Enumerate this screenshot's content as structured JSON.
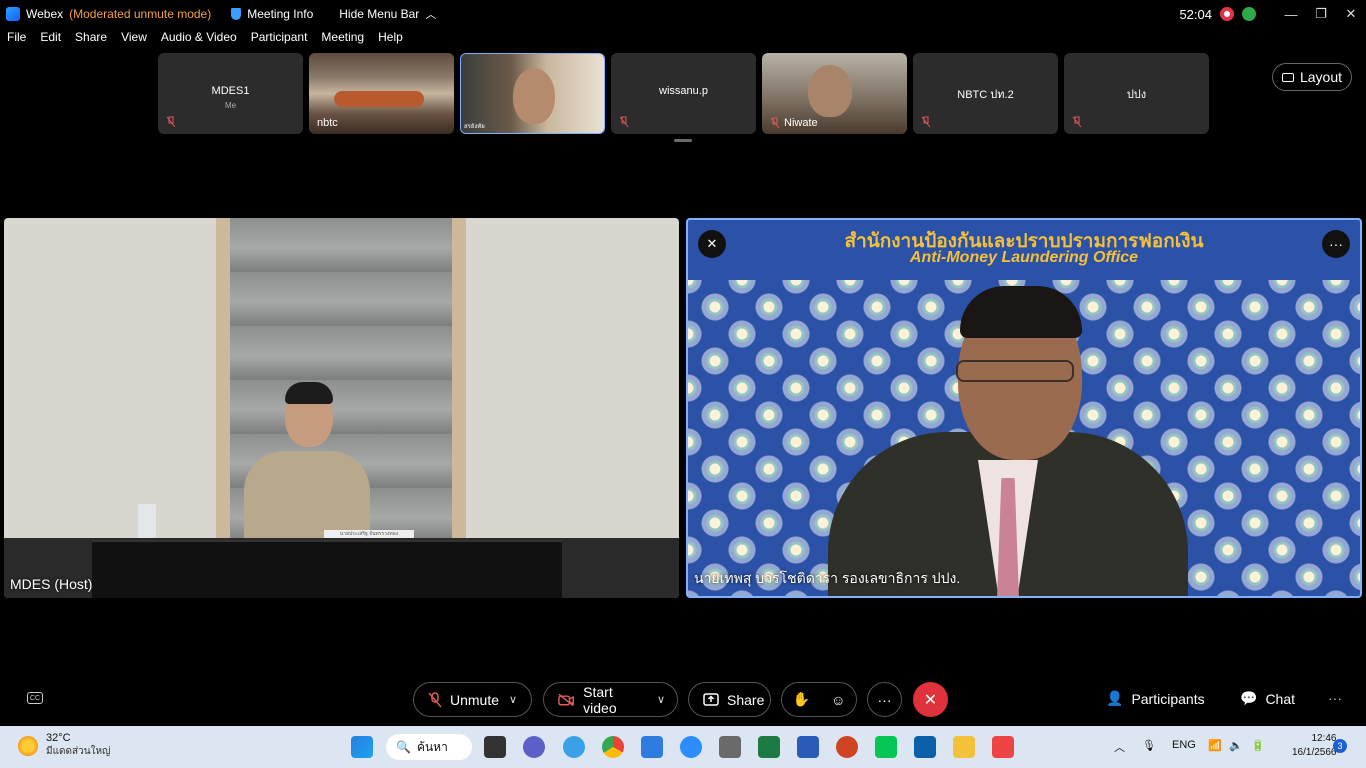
{
  "titlebar": {
    "app": "Webex",
    "mode": "(Moderated unmute mode)",
    "meeting_info": "Meeting Info",
    "hide_menu": "Hide Menu Bar",
    "timer": "52:04"
  },
  "menu": [
    "File",
    "Edit",
    "Share",
    "View",
    "Audio & Video",
    "Participant",
    "Meeting",
    "Help"
  ],
  "thumbnails": [
    {
      "name": "MDES1",
      "sub": "Me"
    },
    {
      "name": "nbtc"
    },
    {
      "name": "สรยังทัย"
    },
    {
      "name": "wissanu.p"
    },
    {
      "name": "Niwate"
    },
    {
      "name": "NBTC ปท.2"
    },
    {
      "name": "ปปง"
    }
  ],
  "layout_button": "Layout",
  "tiles": {
    "left_caption": "MDES (Host)",
    "left_nameplate": "นายประเสริฐ จันทรรวงทอง",
    "right_banner_th": "สำนักงานป้องกันและปราบปรามการฟอกเงิน",
    "right_banner_en": "Anti-Money Laundering Office",
    "right_caption": "นายเทพสุ บวรโชติดารา รองเลขาธิการ ปปง."
  },
  "controls": {
    "unmute": "Unmute",
    "start_video": "Start video",
    "share": "Share",
    "participants": "Participants",
    "chat": "Chat"
  },
  "taskbar": {
    "temperature": "32°C",
    "weather_text": "มีแดดส่วนใหญ่",
    "search": "ค้นหา",
    "lang": "ENG",
    "time": "12:46",
    "date": "16/1/2566",
    "notifications": "3"
  }
}
